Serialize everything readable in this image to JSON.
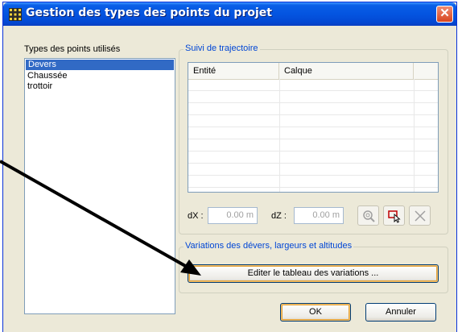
{
  "window": {
    "title": "Gestion des types des points du projet",
    "close_symbol": "✕"
  },
  "left_panel": {
    "label": "Types des points utilisés",
    "items": [
      "Devers",
      "Chaussée",
      "trottoir"
    ],
    "selected_index": 0
  },
  "trajectory_group": {
    "title": "Suivi de trajectoire",
    "columns": [
      "Entité",
      "Calque"
    ],
    "dx_label": "dX :",
    "dx_value": "0.00 m",
    "dz_label": "dZ :",
    "dz_value": "0.00 m",
    "tools": [
      "zoom-icon",
      "select-entity-icon",
      "delete-icon"
    ]
  },
  "variations_group": {
    "title": "Variations des dévers, largeurs et altitudes",
    "edit_button_label": "Editer le tableau des variations ..."
  },
  "footer": {
    "ok_label": "OK",
    "cancel_label": "Annuler"
  },
  "colors": {
    "titlebar": "#0454e0",
    "selection": "#316ac5",
    "group_title": "#0046d5",
    "arrow": "#000000"
  }
}
